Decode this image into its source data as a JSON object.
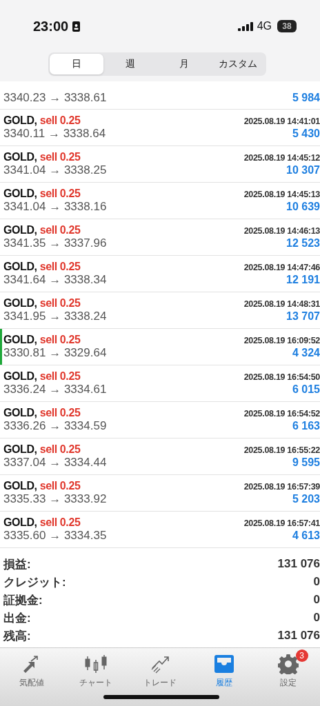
{
  "status_bar": {
    "time": "23:00",
    "network": "4G",
    "battery": "38"
  },
  "period_tabs": [
    {
      "label": "日",
      "selected": true
    },
    {
      "label": "週",
      "selected": false
    },
    {
      "label": "月",
      "selected": false
    },
    {
      "label": "カスタム",
      "selected": false
    }
  ],
  "partial_row": {
    "prices": "3340.23 → 3338.61",
    "profit": "5 984"
  },
  "deals": [
    {
      "symbol": "GOLD,",
      "side": "sell 0.25",
      "time": "2025.08.19 14:41:01",
      "prices": "3340.11 → 3338.64",
      "profit": "5 430",
      "marked": false
    },
    {
      "symbol": "GOLD,",
      "side": "sell 0.25",
      "time": "2025.08.19 14:45:12",
      "prices": "3341.04 → 3338.25",
      "profit": "10 307",
      "marked": false
    },
    {
      "symbol": "GOLD,",
      "side": "sell 0.25",
      "time": "2025.08.19 14:45:13",
      "prices": "3341.04 → 3338.16",
      "profit": "10 639",
      "marked": false
    },
    {
      "symbol": "GOLD,",
      "side": "sell 0.25",
      "time": "2025.08.19 14:46:13",
      "prices": "3341.35 → 3337.96",
      "profit": "12 523",
      "marked": false
    },
    {
      "symbol": "GOLD,",
      "side": "sell 0.25",
      "time": "2025.08.19 14:47:46",
      "prices": "3341.64 → 3338.34",
      "profit": "12 191",
      "marked": false
    },
    {
      "symbol": "GOLD,",
      "side": "sell 0.25",
      "time": "2025.08.19 14:48:31",
      "prices": "3341.95 → 3338.24",
      "profit": "13 707",
      "marked": false
    },
    {
      "symbol": "GOLD,",
      "side": "sell 0.25",
      "time": "2025.08.19 16:09:52",
      "prices": "3330.81 → 3329.64",
      "profit": "4 324",
      "marked": true
    },
    {
      "symbol": "GOLD,",
      "side": "sell 0.25",
      "time": "2025.08.19 16:54:50",
      "prices": "3336.24 → 3334.61",
      "profit": "6 015",
      "marked": false
    },
    {
      "symbol": "GOLD,",
      "side": "sell 0.25",
      "time": "2025.08.19 16:54:52",
      "prices": "3336.26 → 3334.59",
      "profit": "6 163",
      "marked": false
    },
    {
      "symbol": "GOLD,",
      "side": "sell 0.25",
      "time": "2025.08.19 16:55:22",
      "prices": "3337.04 → 3334.44",
      "profit": "9 595",
      "marked": false
    },
    {
      "symbol": "GOLD,",
      "side": "sell 0.25",
      "time": "2025.08.19 16:57:39",
      "prices": "3335.33 → 3333.92",
      "profit": "5 203",
      "marked": false
    },
    {
      "symbol": "GOLD,",
      "side": "sell 0.25",
      "time": "2025.08.19 16:57:41",
      "prices": "3335.60 → 3334.35",
      "profit": "4 613",
      "marked": false
    }
  ],
  "summary": [
    {
      "label": "損益:",
      "value": "131 076"
    },
    {
      "label": "クレジット:",
      "value": "0"
    },
    {
      "label": "証拠金:",
      "value": "0"
    },
    {
      "label": "出金:",
      "value": "0"
    },
    {
      "label": "残高:",
      "value": "131 076"
    }
  ],
  "tab_bar": [
    {
      "kind": "quotes",
      "label": "気配値",
      "selected": false
    },
    {
      "kind": "chart",
      "label": "チャート",
      "selected": false
    },
    {
      "kind": "trade",
      "label": "トレード",
      "selected": false
    },
    {
      "kind": "history",
      "label": "履歴",
      "selected": true
    },
    {
      "kind": "settings",
      "label": "設定",
      "selected": false,
      "badge": "3"
    }
  ]
}
